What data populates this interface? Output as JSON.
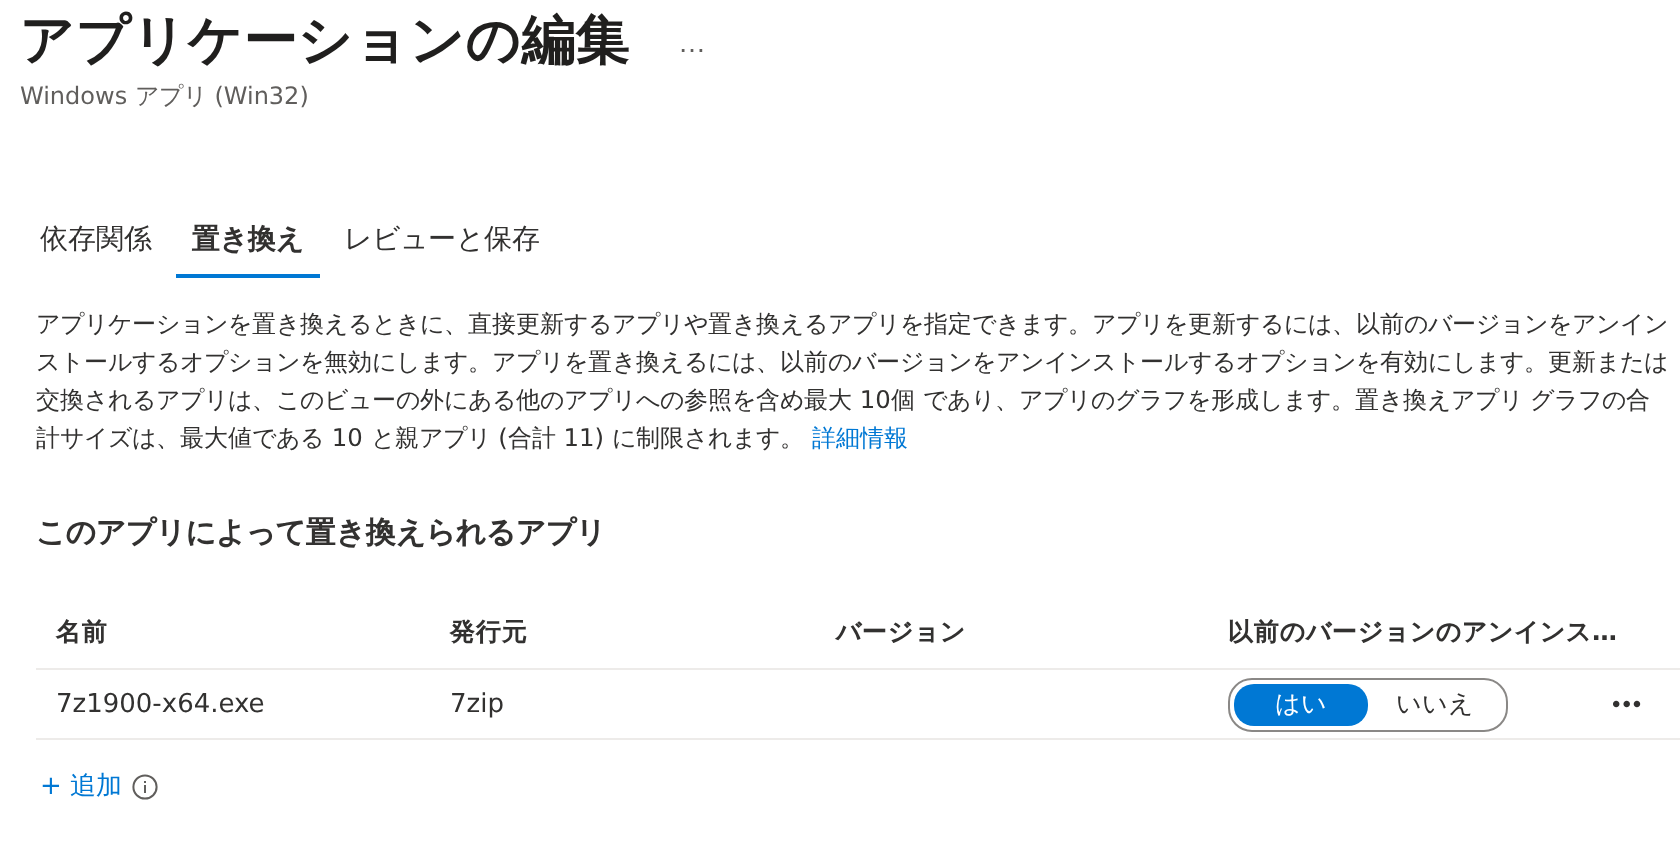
{
  "header": {
    "title": "アプリケーションの編集",
    "more_button": "…",
    "subtitle": "Windows アプリ (Win32)"
  },
  "tabs": [
    {
      "label": "依存関係",
      "selected": false
    },
    {
      "label": "置き換え",
      "selected": true
    },
    {
      "label": "レビューと保存",
      "selected": false
    }
  ],
  "description": {
    "text": "アプリケーションを置き換えるときに、直接更新するアプリや置き換えるアプリを指定できます。アプリを更新するには、以前のバージョンをアンインストールするオプションを無効にします。アプリを置き換えるには、以前のバージョンをアンインストールするオプションを有効にします。更新または交換されるアプリは、このビューの外にある他のアプリへの参照を含め最大 10個 であり、アプリのグラフを形成します。置き換えアプリ グラフの合計サイズは、最大値である 10 と親アプリ (合計 11) に制限されます。",
    "link": "詳細情報"
  },
  "section": {
    "title": "このアプリによって置き換えられるアプリ"
  },
  "table": {
    "columns": [
      "名前",
      "発行元",
      "バージョン",
      "以前のバージョンのアンインス…"
    ],
    "rows": [
      {
        "name": "7z1900-x64.exe",
        "publisher": "7zip",
        "uninstall_options": [
          {
            "label": "はい",
            "selected": true
          },
          {
            "label": "いいえ",
            "selected": false
          }
        ],
        "more": "•••"
      }
    ]
  },
  "add_button": {
    "label": "+ 追加"
  }
}
